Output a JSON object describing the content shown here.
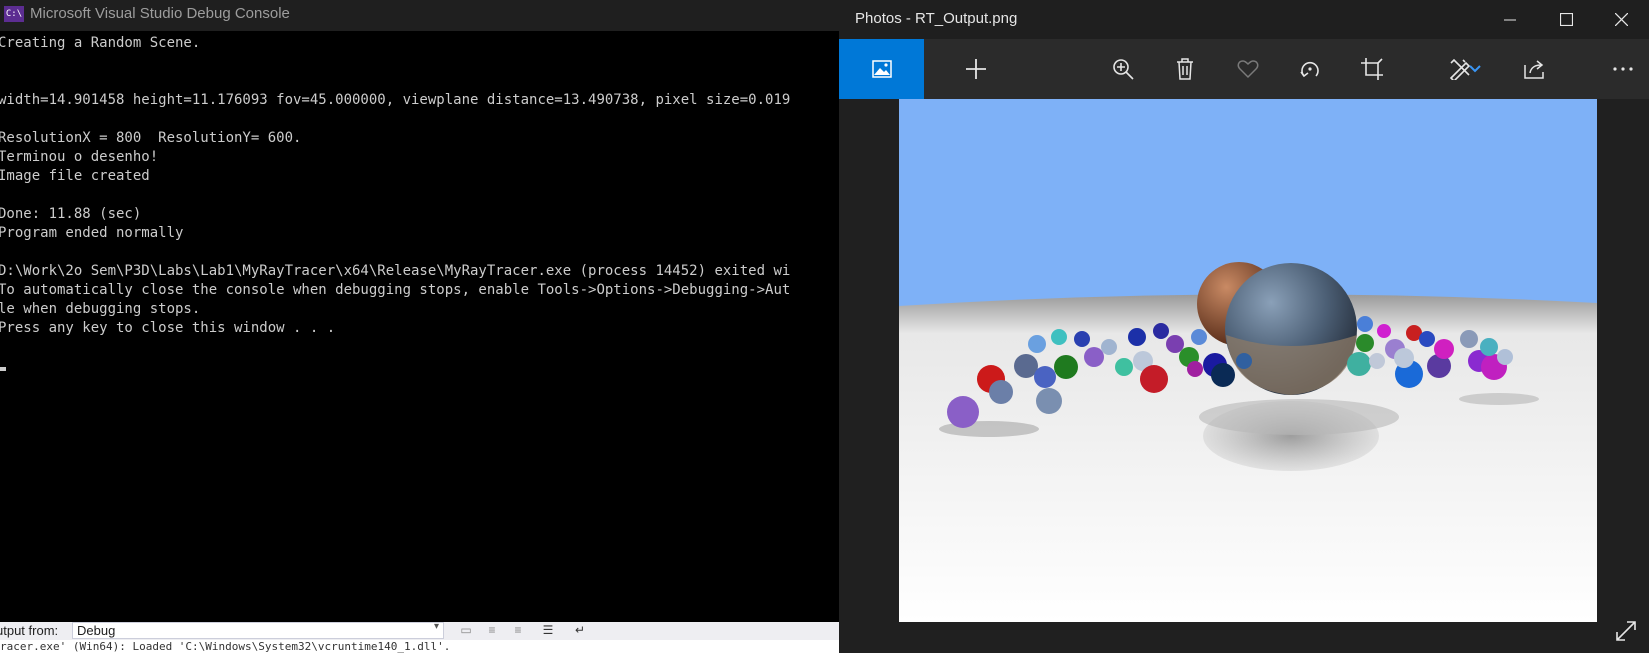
{
  "console": {
    "title": "Microsoft Visual Studio Debug Console",
    "icon_text": "C:\\",
    "lines": [
      "Creating a Random Scene.",
      "",
      "",
      "width=14.901458 height=11.176093 fov=45.000000, viewplane distance=13.490738, pixel size=0.019",
      "",
      "ResolutionX = 800  ResolutionY= 600.",
      "Terminou o desenho!",
      "Image file created",
      "",
      "Done: 11.88 (sec)",
      "Program ended normally",
      "",
      "D:\\Work\\2o Sem\\P3D\\Labs\\Lab1\\MyRayTracer\\x64\\Release\\MyRayTracer.exe (process 14452) exited wi",
      "To automatically close the console when debugging stops, enable Tools->Options->Debugging->Aut",
      "le when debugging stops.",
      "Press any key to close this window . . ."
    ]
  },
  "output_pane": {
    "label": "utput from:",
    "source_value": "Debug",
    "bottom_text": "racer.exe' (Win64): Loaded 'C:\\Windows\\System32\\vcruntime140_1.dll'."
  },
  "photos": {
    "title": "Photos - RT_Output.png",
    "toolbar_icons": [
      "picture-icon",
      "add-icon",
      "zoom-icon",
      "delete-icon",
      "favorite-icon",
      "rotate-icon",
      "crop-icon",
      "edit-icon",
      "share-icon",
      "more-icon"
    ],
    "colors": {
      "accent": "#0078d7",
      "sky": "#7eb1f7"
    }
  }
}
